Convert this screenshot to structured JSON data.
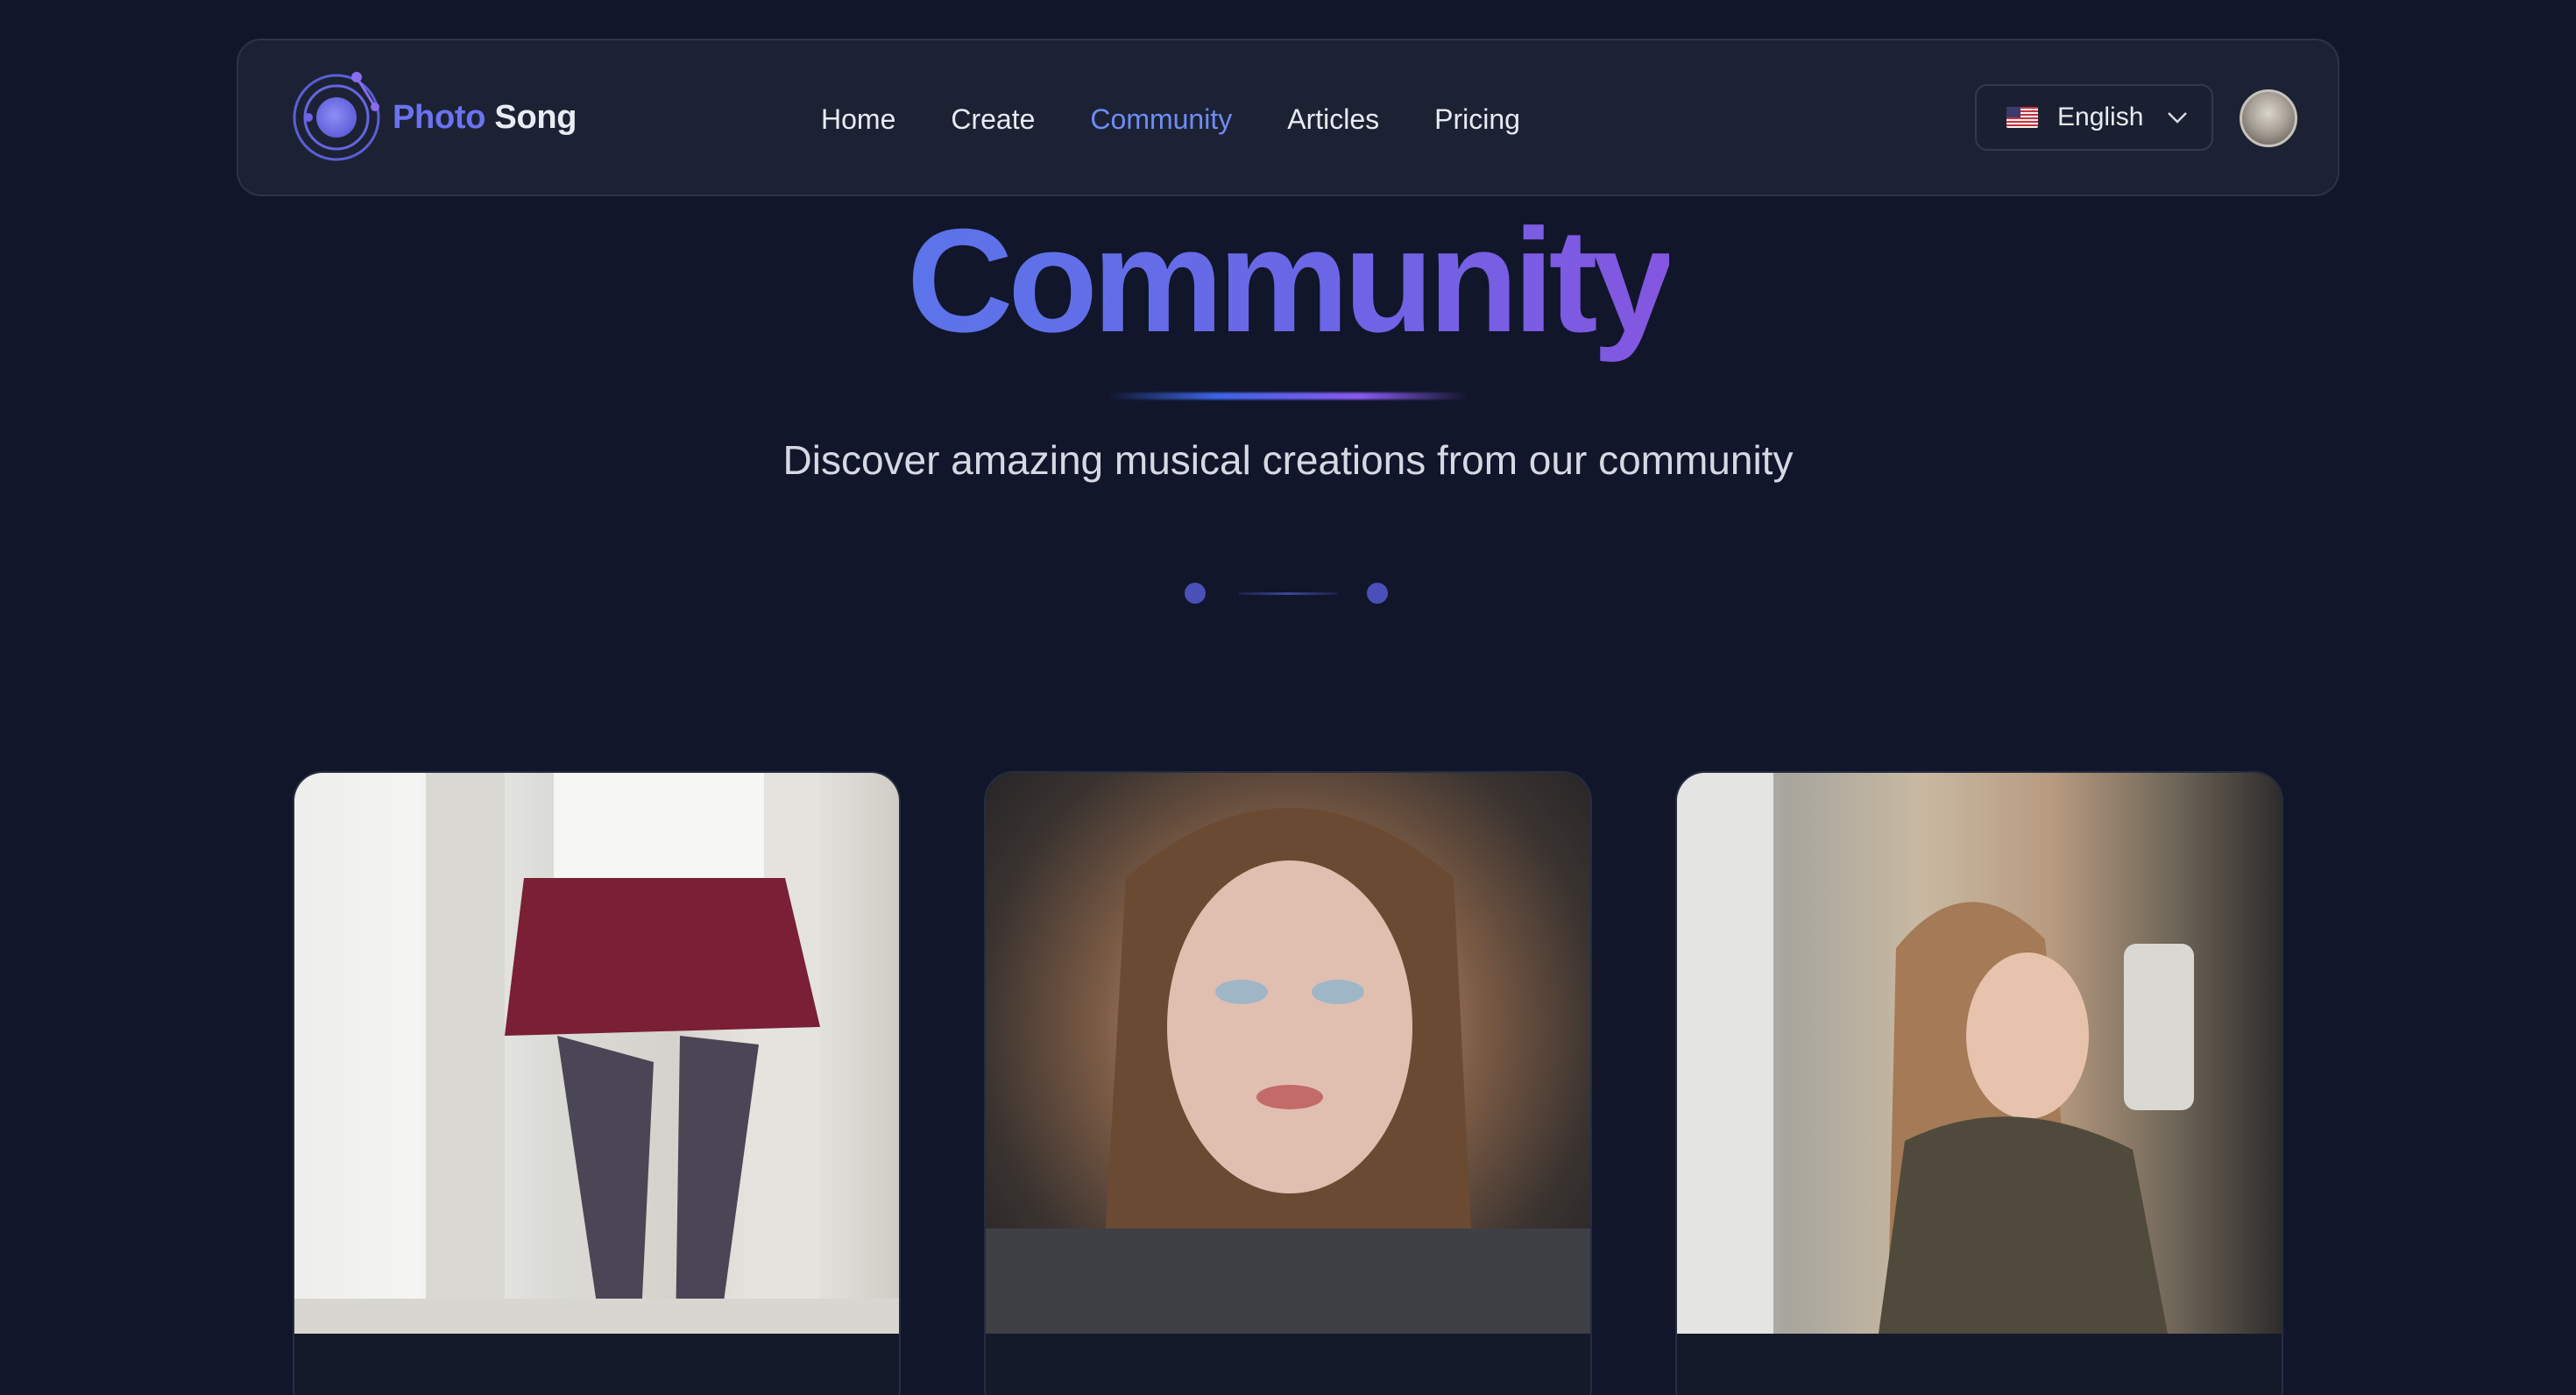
{
  "nav": {
    "brand_part1": "Photo",
    "brand_part2": "Song",
    "links": [
      {
        "label": "Home",
        "active": false
      },
      {
        "label": "Create",
        "active": false
      },
      {
        "label": "Community",
        "active": true
      },
      {
        "label": "Articles",
        "active": false
      },
      {
        "label": "Pricing",
        "active": false
      }
    ],
    "language": "English",
    "language_icon": "us-flag-icon",
    "dropdown_icon": "chevron-down-icon"
  },
  "hero": {
    "title": "Community",
    "subtitle": "Discover amazing musical creations from our community"
  },
  "cards": [
    {
      "image": "community-photo-1"
    },
    {
      "image": "community-photo-2"
    },
    {
      "image": "community-photo-3"
    }
  ],
  "colors": {
    "background": "#11162a",
    "nav_bg": "#1c2234",
    "accent_blue": "#6f8cf7",
    "accent_purple": "#8456e0"
  }
}
